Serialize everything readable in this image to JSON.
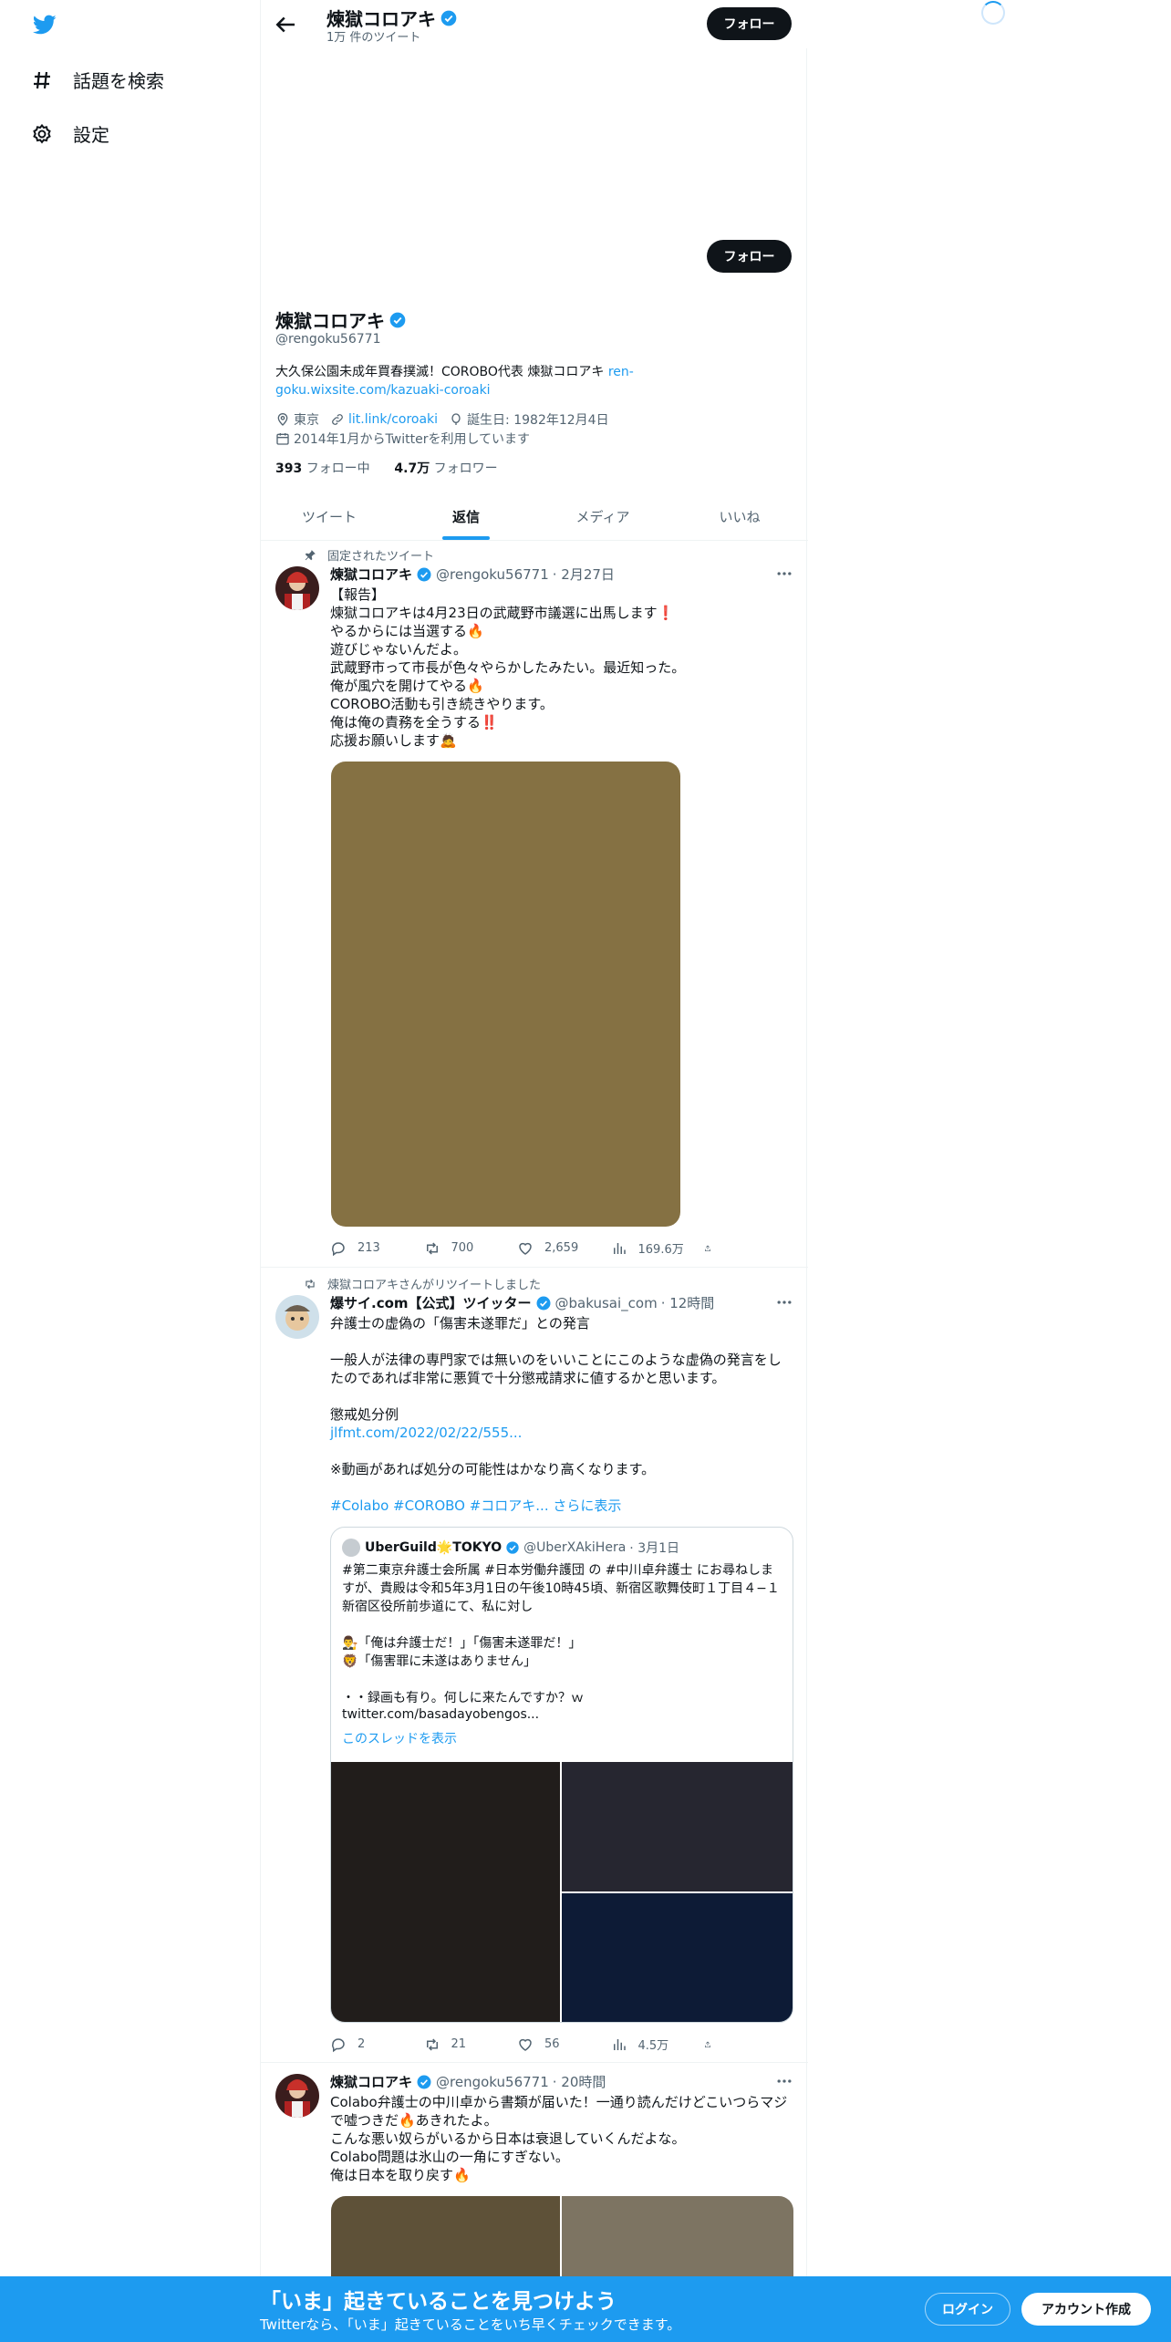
{
  "colors": {
    "accent": "#1d9bf0",
    "dark": "#0f1419",
    "secondary": "#536471"
  },
  "nav": {
    "explore_label": "話題を検索",
    "settings_label": "設定"
  },
  "header": {
    "name": "煉獄コロアキ",
    "tweet_count": "1万 件のツイート",
    "follow_label": "フォロー"
  },
  "profile": {
    "follow_label": "フォロー",
    "name": "煉獄コロアキ",
    "handle": "@rengoku56771",
    "bio_text": "大久保公園未成年買春撲滅！COROBO代表 煉獄コロアキ ",
    "bio_link": "ren-goku.wixsite.com/kazuaki-coroaki",
    "location": "東京",
    "url": "lit.link/coroaki",
    "birthday": "誕生日: 1982年12月4日",
    "joined": "2014年1月からTwitterを利用しています",
    "following_count": "393",
    "following_label": "フォロー中",
    "followers_count": "4.7万",
    "followers_label": "フォロワー"
  },
  "tabs": [
    {
      "label": "ツイート"
    },
    {
      "label": "返信"
    },
    {
      "label": "メディア"
    },
    {
      "label": "いいね"
    }
  ],
  "tweets": [
    {
      "context": "固定されたツイート",
      "name": "煉獄コロアキ",
      "handle": "@rengoku56771",
      "time": "· 2月27日",
      "text": "【報告】\n煉獄コロアキは4月23日の武蔵野市議選に出馬します❗\nやるからには当選する🔥\n遊びじゃないんだよ。\n武蔵野市って市長が色々やらかしたみたい。最近知った。\n俺が風穴を開けてやる🔥\nCOROBO活動も引き続きやります。\n俺は俺の責務を全うする‼️\n応援お願いします🙇",
      "replies": "213",
      "retweets": "700",
      "likes": "2,659",
      "views": "169.6万"
    },
    {
      "context": "煉獄コロアキさんがリツイートしました",
      "name": "爆サイ.com【公式】ツイッター",
      "handle": "@bakusai_com",
      "time": "· 12時間",
      "text": "弁護士の虚偽の「傷害未遂罪だ」との発言\n\n一般人が法律の専門家では無いのをいいことにこのような虚偽の発言をしたのであれば非常に悪質で十分懲戒請求に値するかと思います。\n\n懲戒処分例",
      "link": "jlfmt.com/2022/02/22/555...",
      "text2": "※動画があれば処分の可能性はかなり高くなります。",
      "tags": "#Colabo #COROBO #コロアキ...",
      "show_more": " さらに表示",
      "quote": {
        "name": "UberGuild🌟TOKYO",
        "handle": "@UberXAkiHera",
        "time": "· 3月1日",
        "text": "#第二東京弁護士会所属 #日本労働弁護団 の #中川卓弁護士 にお尋ねしますが、貴殿は令和5年3月1日の午後10時45頃、新宿区歌舞伎町１丁目４−１新宿区役所前歩道にて、私に対し\n\n👨‍⚖️「俺は弁護士だ！」「傷害未遂罪だ！」\n🦁「傷害罪に未遂はありません」\n\n・・録画も有り。何しに来たんですか？ｗ",
        "link": "twitter.com/basadayobengos...",
        "thread": "このスレッドを表示"
      },
      "replies": "2",
      "retweets": "21",
      "likes": "56",
      "views": "4.5万"
    },
    {
      "name": "煉獄コロアキ",
      "handle": "@rengoku56771",
      "time": "· 20時間",
      "text": "Colabo弁護士の中川卓から書類が届いた！一通り読んだけどこいつらマジで嘘つきだ🔥あきれたよ。\nこんな悪い奴らがいるから日本は衰退していくんだよな。\nColabo問題は氷山の一角にすぎない。\n俺は日本を取り戻す🔥"
    }
  ],
  "bottom_bar": {
    "title": "「いま」起きていることを見つけよう",
    "subtitle": "Twitterなら、「いま」起きていることをいち早くチェックできます。",
    "login": "ログイン",
    "signup": "アカウント作成"
  }
}
